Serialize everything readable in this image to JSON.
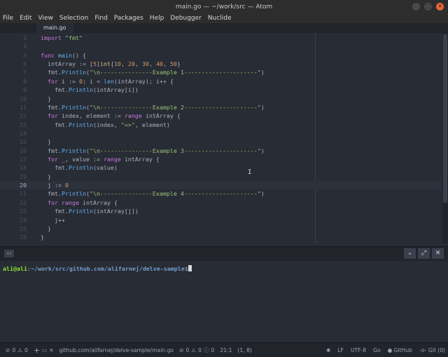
{
  "window": {
    "title": "main.go — ~/work/src — Atom"
  },
  "menu": [
    "File",
    "Edit",
    "View",
    "Selection",
    "Find",
    "Packages",
    "Help",
    "Debugger",
    "Nuclide"
  ],
  "tab": {
    "label": "main.go"
  },
  "editor": {
    "cursor_line": 20,
    "lines": [
      {
        "n": "3",
        "html": "<span class='k'>import</span> <span class='s'>\"fmt\"</span>"
      },
      {
        "n": "4",
        "html": ""
      },
      {
        "n": "5",
        "html": "<span class='k'>func</span> <span class='f'>main</span>() {"
      },
      {
        "n": "6",
        "html": "  intArray := [<span class='n'>5</span>]<span class='t'>int</span>{<span class='n'>10</span>, <span class='n'>20</span>, <span class='n'>30</span>, <span class='n'>40</span>, <span class='n'>50</span>}"
      },
      {
        "n": "7",
        "html": "  fmt.<span class='f'>Println</span>(<span class='s'>\"\\n---------------Example 1---------------------\"</span>)"
      },
      {
        "n": "8",
        "html": "  <span class='k'>for</span> i := <span class='n'>0</span>; i &lt; <span class='f'>len</span>(intArray); i++ {"
      },
      {
        "n": "9",
        "html": "    fmt.<span class='f'>Println</span>(intArray[i])"
      },
      {
        "n": "10",
        "html": "  }"
      },
      {
        "n": "11",
        "html": "  fmt.<span class='f'>Println</span>(<span class='s'>\"\\n---------------Example 2---------------------\"</span>)"
      },
      {
        "n": "12",
        "html": "  <span class='k'>for</span> index, element := <span class='k'>range</span> intArray {"
      },
      {
        "n": "13",
        "html": "    fmt.<span class='f'>Println</span>(index, <span class='s'>\"=&gt;\"</span>, element)"
      },
      {
        "n": "14",
        "html": ""
      },
      {
        "n": "15",
        "html": "  }"
      },
      {
        "n": "16",
        "html": "  fmt.<span class='f'>Println</span>(<span class='s'>\"\\n---------------Example 3---------------------\"</span>)"
      },
      {
        "n": "17",
        "html": "  <span class='k'>for</span> _, value := <span class='k'>range</span> intArray {"
      },
      {
        "n": "18",
        "html": "    fmt.<span class='f'>Println</span>(value)"
      },
      {
        "n": "19",
        "html": "  }"
      },
      {
        "n": "20",
        "html": "  j := <span class='n'>0</span>"
      },
      {
        "n": "21",
        "html": "  fmt.<span class='f'>Println</span>(<span class='s'>\"\\n---------------Example 4---------------------\"</span>)"
      },
      {
        "n": "22",
        "html": "  <span class='k'>for</span> <span class='k'>range</span> intArray {"
      },
      {
        "n": "23",
        "html": "    fmt.<span class='f'>Println</span>(intArray[j])"
      },
      {
        "n": "24",
        "html": "    j++"
      },
      {
        "n": "25",
        "html": "  }"
      },
      {
        "n": "26",
        "html": "}"
      },
      {
        "n": "27",
        "html": ""
      }
    ]
  },
  "terminal": {
    "user": "ali@ali",
    "sep": ":",
    "path": "~/work/src/github.com/alifarnej/delve-sample",
    "prompt": "$"
  },
  "status": {
    "errors": "0",
    "warnings": "0",
    "file_path": "github.com/alifarnej/delve-sample/main.go",
    "diag_errors": "0",
    "diag_warnings": "0",
    "diag_info": "0",
    "cursor_pos": "21:1",
    "selection": "(1, 8)",
    "line_ending": "LF",
    "encoding": "UTF-8",
    "grammar": "Go",
    "github": "GitHub",
    "git": "Git (0)"
  }
}
